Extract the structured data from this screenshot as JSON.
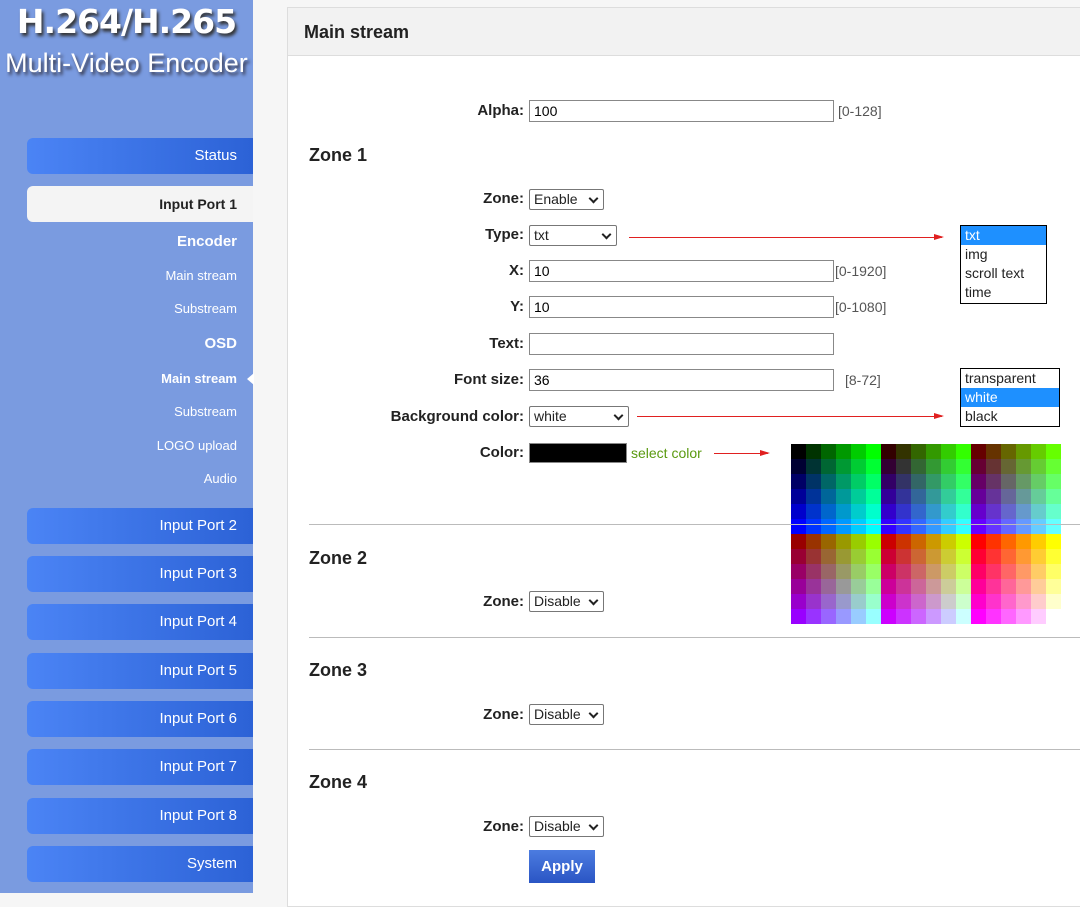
{
  "logo": {
    "line1": "H.264/H.265",
    "line2": "Multi-Video Encoder"
  },
  "sidebar": {
    "status": "Status",
    "input_port_1": "Input Port 1",
    "encoder": "Encoder",
    "encoder_main": "Main stream",
    "encoder_sub": "Substream",
    "osd": "OSD",
    "osd_main": "Main stream",
    "osd_sub": "Substream",
    "logo_upload": "LOGO upload",
    "audio": "Audio",
    "ports": [
      "Input Port 2",
      "Input Port 3",
      "Input Port 4",
      "Input Port 5",
      "Input Port 6",
      "Input Port 7",
      "Input Port 8"
    ],
    "system": "System"
  },
  "panel": {
    "title": "Main stream"
  },
  "form": {
    "alpha_label": "Alpha:",
    "alpha": "100",
    "alpha_range": "[0-128]",
    "zone1": {
      "title": "Zone 1",
      "zone_label": "Zone:",
      "zone": "Enable",
      "type_label": "Type:",
      "type": "txt",
      "x_label": "X:",
      "x": "10",
      "x_range": "[0-1920]",
      "y_label": "Y:",
      "y": "10",
      "y_range": "[0-1080]",
      "text_label": "Text:",
      "text": "",
      "font_label": "Font size:",
      "font_size": "36",
      "font_range": "[8-72]",
      "bg_label": "Background color:",
      "bg": "white",
      "color_label": "Color:",
      "color": "#000000",
      "select_color": "select color"
    },
    "zone2": {
      "title": "Zone 2",
      "zone_label": "Zone:",
      "zone": "Disable"
    },
    "zone3": {
      "title": "Zone 3",
      "zone_label": "Zone:",
      "zone": "Disable"
    },
    "zone4": {
      "title": "Zone 4",
      "zone_label": "Zone:",
      "zone": "Disable"
    },
    "apply": "Apply"
  },
  "type_options": [
    "txt",
    "img",
    "scroll text",
    "time"
  ],
  "type_selected": "txt",
  "bg_options": [
    "transparent",
    "white",
    "black"
  ],
  "bg_selected": "white",
  "colors": {
    "sidebar": "#7a9be0",
    "highlight": "#1e90ff",
    "arrow": "#e02020",
    "select_color_text": "#5a9a10"
  }
}
